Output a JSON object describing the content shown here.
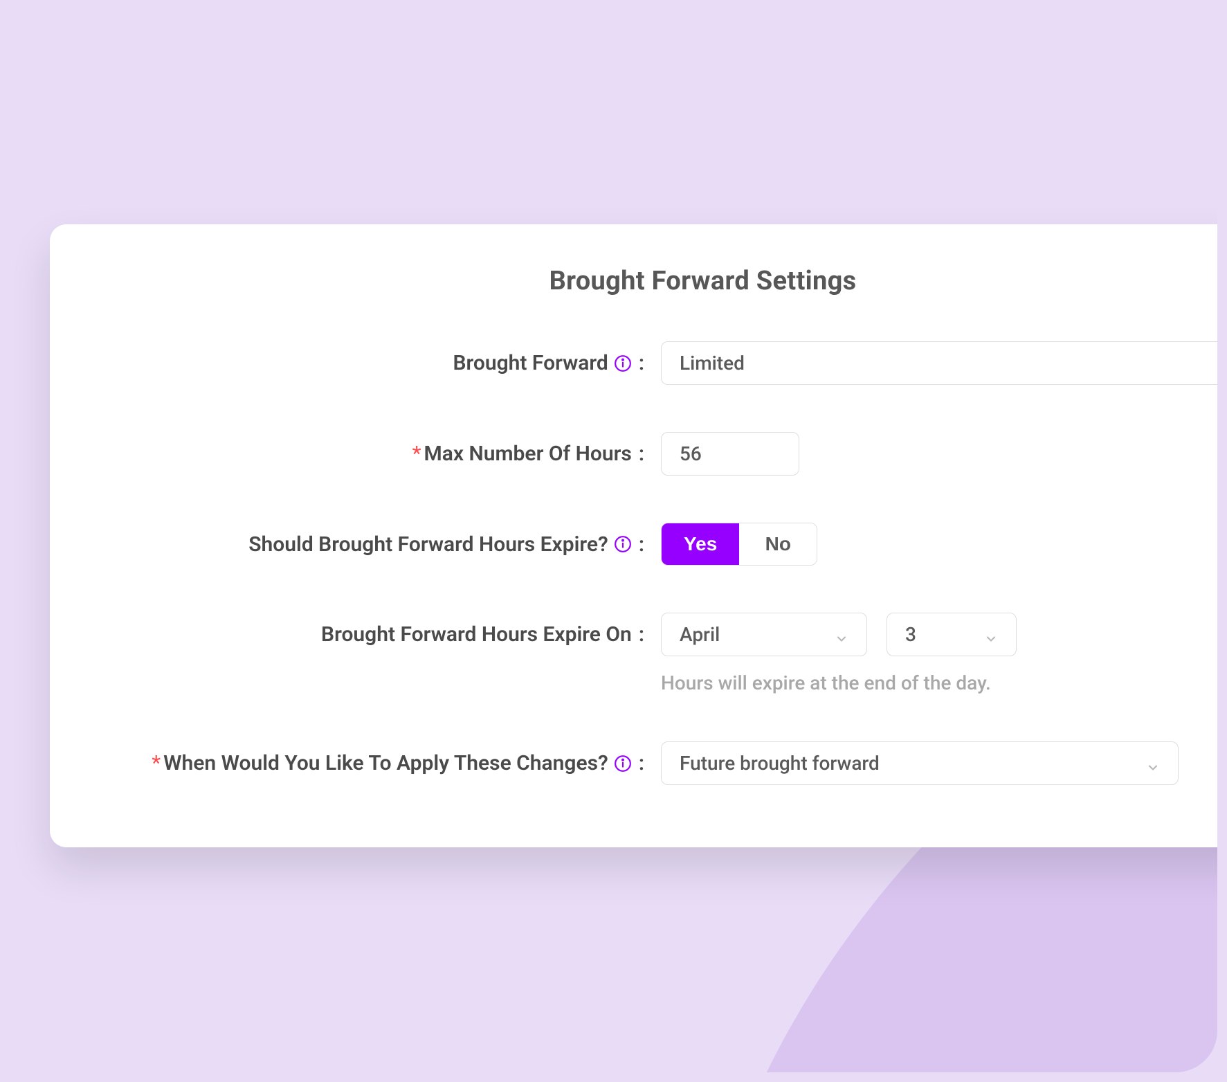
{
  "title": "Brought Forward Settings",
  "colors": {
    "accent": "#9500ff",
    "required": "#ff4d4f"
  },
  "fields": {
    "broughtForward": {
      "label": "Brought Forward",
      "value": "Limited",
      "hasInfo": true
    },
    "maxHours": {
      "label": "Max Number Of Hours",
      "value": "56",
      "required": true
    },
    "shouldExpire": {
      "label": "Should Brought Forward Hours Expire?",
      "hasInfo": true,
      "options": {
        "yes": "Yes",
        "no": "No"
      },
      "selected": "yes"
    },
    "expireOn": {
      "label": "Brought Forward Hours Expire On",
      "month": "April",
      "day": "3",
      "hint": "Hours will expire at the end of the day."
    },
    "applyChanges": {
      "label": "When Would You Like To Apply These Changes?",
      "value": "Future brought forward",
      "required": true,
      "hasInfo": true
    }
  }
}
